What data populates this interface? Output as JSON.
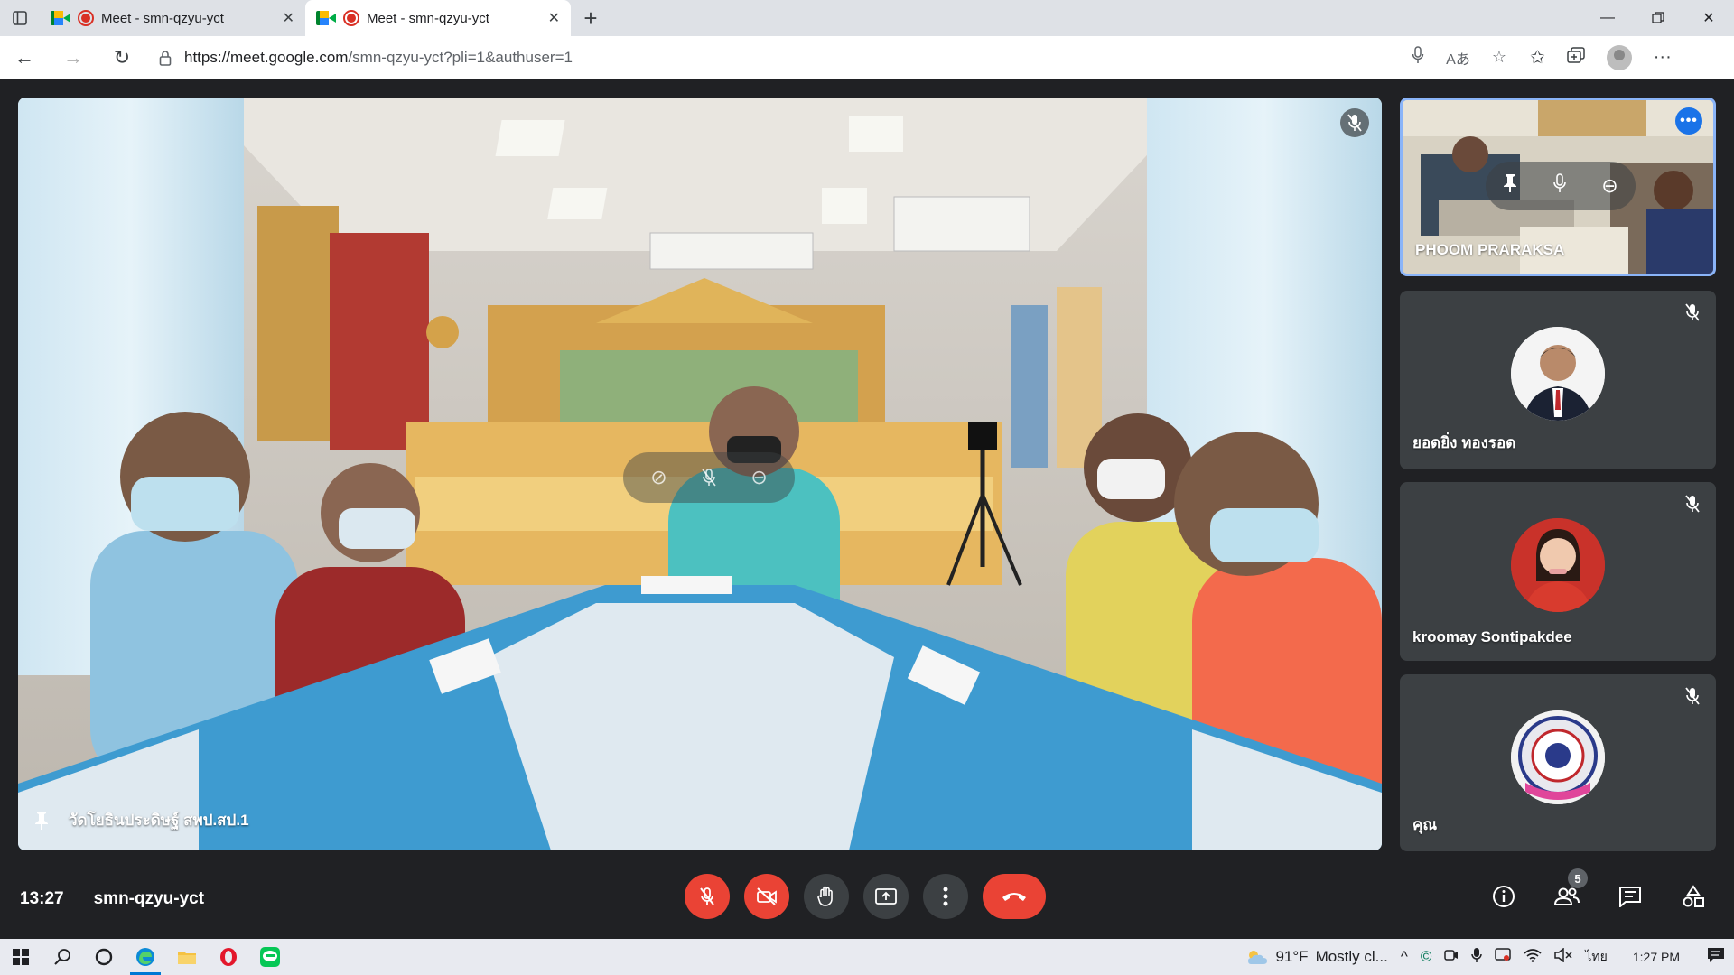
{
  "browser": {
    "tabs": [
      {
        "title": "Meet - smn-qzyu-yct",
        "active": false
      },
      {
        "title": "Meet - smn-qzyu-yct",
        "active": true
      }
    ],
    "url_host": "https://meet.google.com",
    "url_path": "/smn-qzyu-yct?pli=1&authuser=1"
  },
  "meeting": {
    "time": "13:27",
    "code": "smn-qzyu-yct",
    "participant_count": "5",
    "main_speaker": {
      "name": "วัดโยธินประดิษฐ์ สพป.สป.1",
      "muted": true,
      "pinned": true
    },
    "tiles": [
      {
        "name": "PHOOM PRARAKSA",
        "video_on": true,
        "active": true
      },
      {
        "name": "ยอดยิ่ง ทองรอด",
        "video_on": false,
        "muted": true
      },
      {
        "name": "kroomay Sontipakdee",
        "video_on": false,
        "muted": true
      },
      {
        "name": "คุณ",
        "video_on": false,
        "muted": true
      }
    ],
    "controls": [
      {
        "name": "microphone",
        "state": "off",
        "icon": "mic-off-icon"
      },
      {
        "name": "camera",
        "state": "off",
        "icon": "videocam-off-icon"
      },
      {
        "name": "raise-hand",
        "icon": "hand-icon"
      },
      {
        "name": "present",
        "icon": "present-screen-icon"
      },
      {
        "name": "more-options",
        "icon": "more-vert-icon"
      },
      {
        "name": "leave-call",
        "icon": "call-end-icon"
      }
    ]
  },
  "taskbar": {
    "weather_temp": "91°F",
    "weather_text": "Mostly cl...",
    "language": "ไทย",
    "clock": "1:27 PM"
  },
  "colors": {
    "meet_bg": "#202124",
    "tile_bg": "#3c4043",
    "active_border": "#8ab4f8",
    "danger": "#ea4335",
    "accent_blue": "#1a73e8"
  }
}
